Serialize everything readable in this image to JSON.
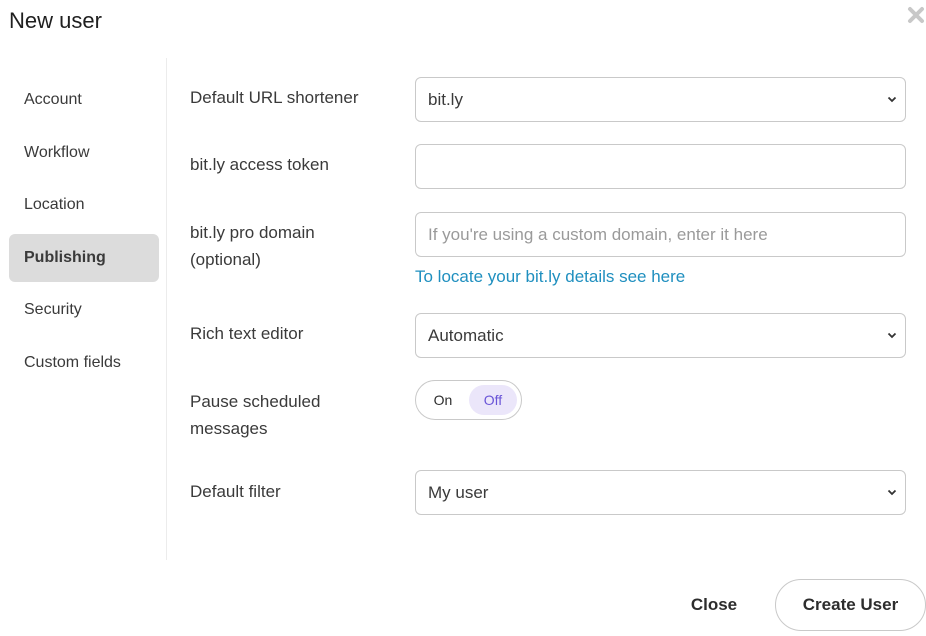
{
  "dialog": {
    "title": "New user"
  },
  "sidebar": {
    "items": [
      {
        "label": "Account"
      },
      {
        "label": "Workflow"
      },
      {
        "label": "Location"
      },
      {
        "label": "Publishing",
        "active": true
      },
      {
        "label": "Security"
      },
      {
        "label": "Custom fields"
      }
    ]
  },
  "form": {
    "url_shortener": {
      "label": "Default URL shortener",
      "value": "bit.ly"
    },
    "access_token": {
      "label": "bit.ly access token",
      "value": ""
    },
    "pro_domain": {
      "label_line1": "bit.ly pro domain",
      "label_line2": "(optional)",
      "value": "",
      "placeholder": "If you're using a custom domain, enter it here",
      "help_link": "To locate your bit.ly details see here"
    },
    "rich_text": {
      "label": "Rich text editor",
      "value": "Automatic"
    },
    "pause_messages": {
      "label_line1": "Pause scheduled",
      "label_line2": "messages",
      "on_label": "On",
      "off_label": "Off",
      "selected": "Off"
    },
    "default_filter": {
      "label": "Default filter",
      "value": "My user"
    }
  },
  "footer": {
    "close_label": "Close",
    "create_label": "Create User"
  },
  "colors": {
    "link": "#1f8fbf",
    "toggle_active_bg": "#ebe6fa",
    "toggle_active_text": "#6a55d8",
    "sidebar_active_bg": "#dcdcdc"
  },
  "icons": {
    "close": "close-icon",
    "select": "chevron-down-icon"
  }
}
